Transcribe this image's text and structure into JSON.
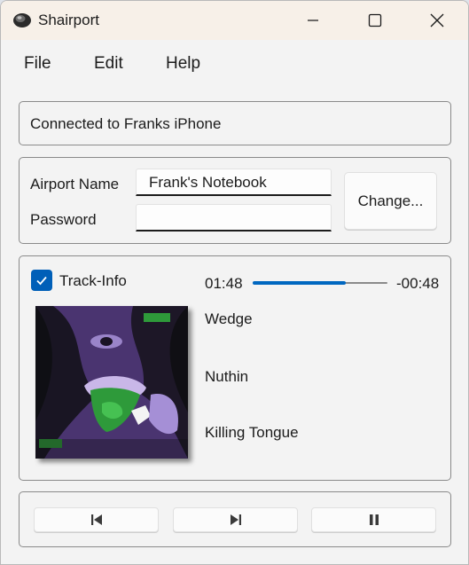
{
  "window": {
    "title": "Shairport",
    "controls": {
      "minimize": "minimize-icon",
      "maximize": "maximize-icon",
      "close": "close-icon"
    }
  },
  "menu": {
    "items": [
      "File",
      "Edit",
      "Help"
    ]
  },
  "status": {
    "text": "Connected to Franks iPhone"
  },
  "airport": {
    "name_label": "Airport Name",
    "name_value": "Frank's Notebook",
    "password_label": "Password",
    "password_value": "",
    "change_button": "Change..."
  },
  "track": {
    "info_checkbox_label": "Track-Info",
    "info_checked": true,
    "elapsed": "01:48",
    "remaining": "-00:48",
    "progress": 0.69,
    "artist": "Wedge",
    "album": "Nuthin",
    "title": "Killing Tongue"
  },
  "controls": {
    "previous": "skip-previous-icon",
    "next": "skip-next-icon",
    "pause": "pause-icon"
  },
  "colors": {
    "accent": "#0067c0",
    "titlebar": "#f7f0e8"
  }
}
